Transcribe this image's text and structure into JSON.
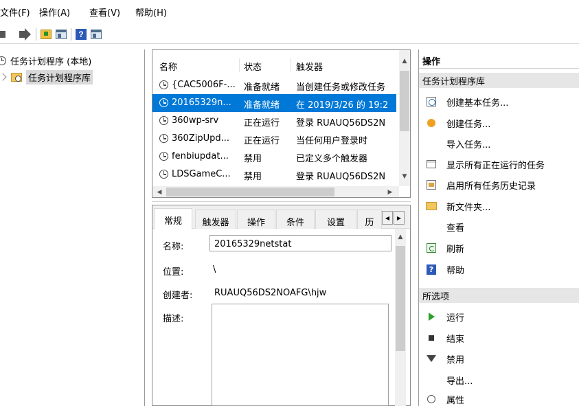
{
  "menu": [
    "文件(F)",
    "操作(A)",
    "查看(V)",
    "帮助(H)"
  ],
  "tree": {
    "root": "任务计划程序 (本地)",
    "library": "任务计划程序库"
  },
  "task_list": {
    "columns": [
      "名称",
      "状态",
      "触发器"
    ],
    "rows": [
      {
        "name": "{CAC5006F-...",
        "status": "准备就绪",
        "trigger": "当创建任务或修改任务"
      },
      {
        "name": "20165329n...",
        "status": "准备就绪",
        "trigger": "在 2019/3/26 的 19:2"
      },
      {
        "name": "360wp-srv",
        "status": "正在运行",
        "trigger": "登录 RUAUQ56DS2N"
      },
      {
        "name": "360ZipUpd...",
        "status": "正在运行",
        "trigger": "当任何用户登录时"
      },
      {
        "name": "fenbiupdat...",
        "status": "禁用",
        "trigger": "已定义多个触发器"
      },
      {
        "name": "LDSGameC...",
        "status": "禁用",
        "trigger": "登录 RUAUQ56DS2N"
      }
    ],
    "selected_index": 1
  },
  "details": {
    "tabs": [
      "常规",
      "触发器",
      "操作",
      "条件",
      "设置",
      "历"
    ],
    "active_tab": 0,
    "fields": {
      "name_label": "名称:",
      "name_value": "20165329netstat",
      "location_label": "位置:",
      "location_value": "\\",
      "author_label": "创建者:",
      "author_value": "RUAUQ56DS2NOAFG\\hjw",
      "description_label": "描述:"
    }
  },
  "actions": {
    "title": "操作",
    "library_section": "任务计划程序库",
    "library_items": [
      {
        "label": "创建基本任务...",
        "icon": "create-basic-task-icon"
      },
      {
        "label": "创建任务...",
        "icon": "create-task-icon"
      },
      {
        "label": "导入任务...",
        "icon": ""
      },
      {
        "label": "显示所有正在运行的任务",
        "icon": "running-tasks-icon"
      },
      {
        "label": "启用所有任务历史记录",
        "icon": "history-icon"
      },
      {
        "label": "新文件夹...",
        "icon": "new-folder-icon"
      },
      {
        "label": "查看",
        "icon": ""
      },
      {
        "label": "刷新",
        "icon": "refresh-icon"
      },
      {
        "label": "帮助",
        "icon": "help-icon"
      }
    ],
    "selected_section": "所选项",
    "selected_items": [
      {
        "label": "运行",
        "icon": "run-icon"
      },
      {
        "label": "结束",
        "icon": "stop-icon"
      },
      {
        "label": "禁用",
        "icon": "disable-icon"
      },
      {
        "label": "导出...",
        "icon": ""
      },
      {
        "label": "属性",
        "icon": "properties-icon"
      }
    ]
  },
  "colors": {
    "selection": "#0078d7",
    "section_header": "#e6e6e6"
  }
}
